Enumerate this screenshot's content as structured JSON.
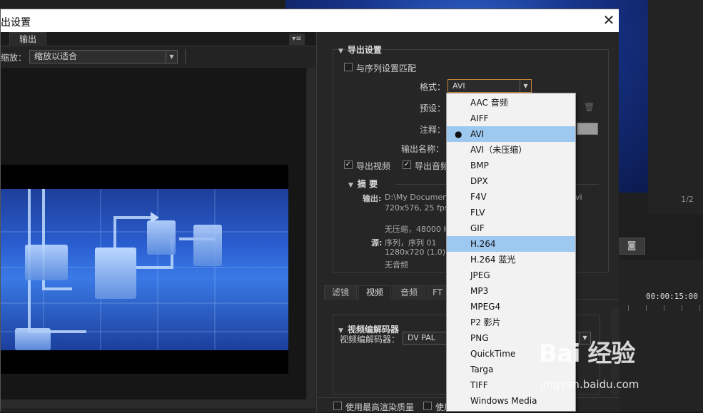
{
  "dialog": {
    "title": "出设置",
    "close_label": "✕"
  },
  "left": {
    "tab_output": "输出",
    "panel_menu": "▾≡",
    "zoom_label": "缩放：",
    "zoom_value": "缩放以适合"
  },
  "export_settings": {
    "header": "导出设置",
    "match_sequence_label": "与序列设置匹配",
    "format_label": "格式：",
    "format_value": "AVI",
    "preset_label": "预设：",
    "comment_label": "注释：",
    "output_name_label": "输出名称：",
    "export_video_label": "导出视频",
    "export_audio_label": "导出音频",
    "summary_header": "摘 要",
    "summary_output_key": "输出:",
    "summary_output_line1": "D:\\My Documents",
    "summary_output_line1_tail": "vi",
    "summary_output_line2": "720x576, 25 fps,",
    "summary_output_line3": "无压缩，48000 H",
    "summary_source_key": "源:",
    "summary_source_line1": "序列，序列 01",
    "summary_source_line2": "1280x720 (1.0), 2",
    "summary_source_line3": "无音频"
  },
  "tabs": [
    {
      "label": "滤镜"
    },
    {
      "label": "视频"
    },
    {
      "label": "音频"
    },
    {
      "label": "FT"
    }
  ],
  "codec": {
    "header": "视频编解码器",
    "label": "视频编解码器：",
    "value": "DV PAL"
  },
  "bottom": {
    "max_render_label": "使用最高渲染质量",
    "use_label": "使用"
  },
  "format_options": [
    {
      "label": "AAC 音频"
    },
    {
      "label": "AIFF"
    },
    {
      "label": "AVI"
    },
    {
      "label": "AVI（未压缩）"
    },
    {
      "label": "BMP"
    },
    {
      "label": "DPX"
    },
    {
      "label": "F4V"
    },
    {
      "label": "FLV"
    },
    {
      "label": "GIF"
    },
    {
      "label": "H.264"
    },
    {
      "label": "H.264 蓝光"
    },
    {
      "label": "JPEG"
    },
    {
      "label": "MP3"
    },
    {
      "label": "MPEG4"
    },
    {
      "label": "P2 影片"
    },
    {
      "label": "PNG"
    },
    {
      "label": "QuickTime"
    },
    {
      "label": "Targa"
    },
    {
      "label": "TIFF"
    },
    {
      "label": "Windows Media"
    }
  ],
  "selected_format": "AVI",
  "hovered_format": "H.264",
  "background": {
    "page_indicator": "1/2",
    "timecode": "00:00:15:00"
  },
  "watermark": {
    "logo": "Bai 经验",
    "url": "jingyan.baidu.com"
  },
  "colors": {
    "accent_border": "#c9863a",
    "selection": "#9dc8f0",
    "preview_blue": "#2a5ed0"
  }
}
